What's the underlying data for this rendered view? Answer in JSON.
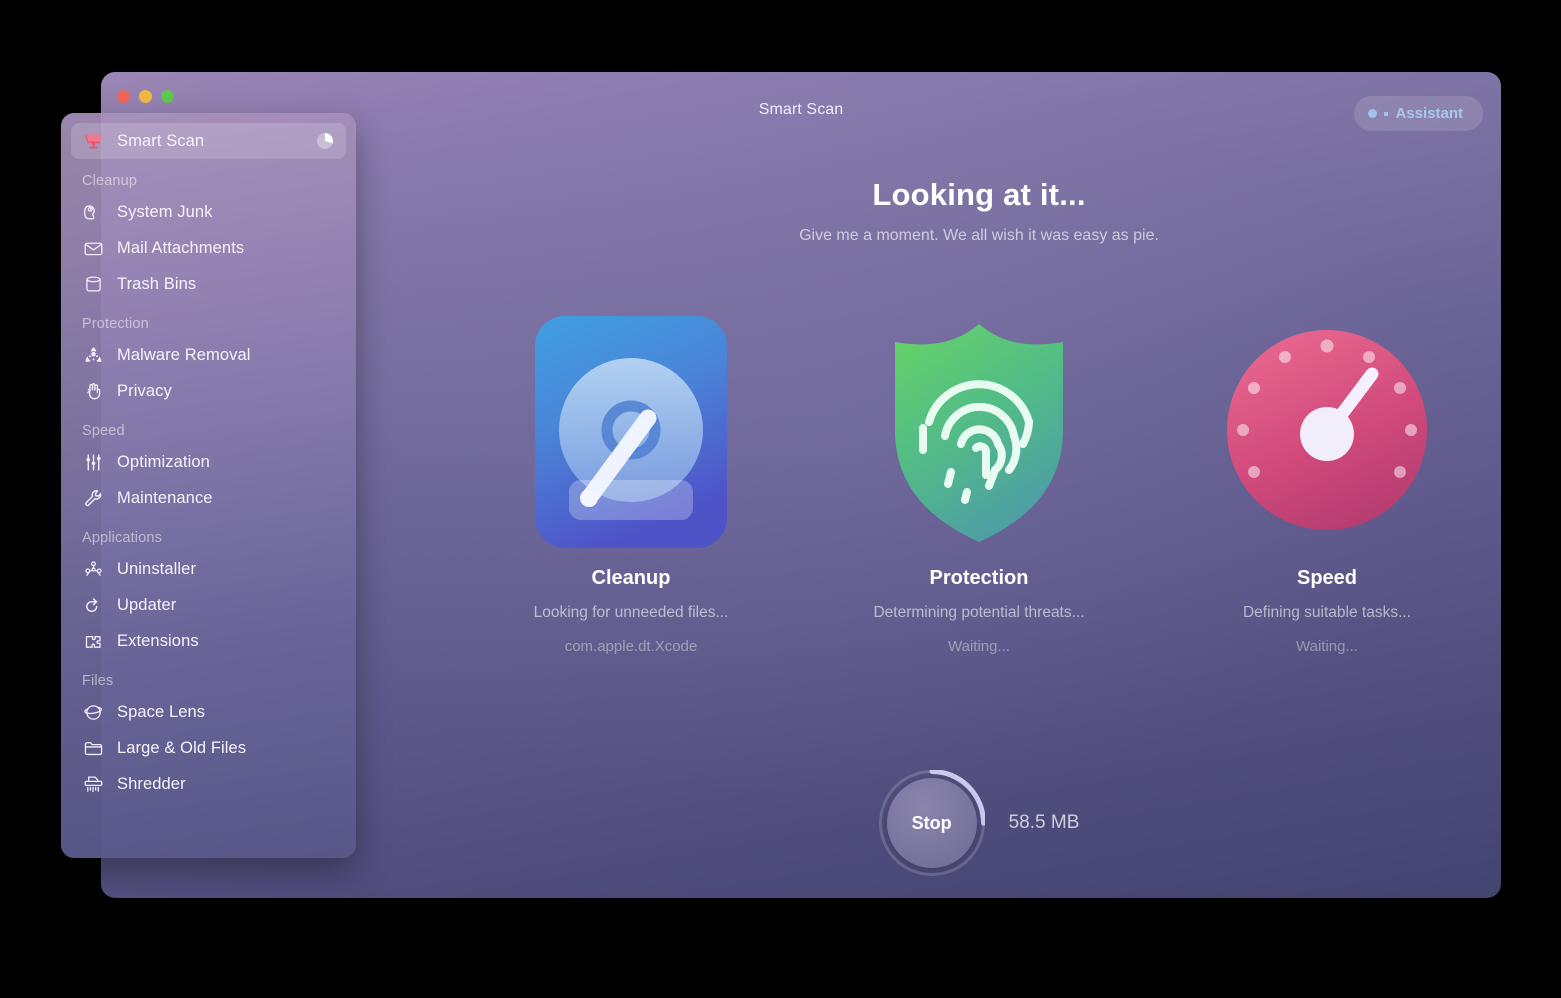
{
  "window": {
    "title": "Smart Scan",
    "traffic_lights": [
      "close",
      "minimize",
      "zoom"
    ],
    "assistant_label": "Assistant"
  },
  "sidebar": {
    "items": [
      {
        "type": "item",
        "label": "Smart Scan",
        "icon": "monitor-icon",
        "selected": true,
        "progress": true
      },
      {
        "type": "group",
        "label": "Cleanup"
      },
      {
        "type": "item",
        "label": "System Junk",
        "icon": "vacuum-icon"
      },
      {
        "type": "item",
        "label": "Mail Attachments",
        "icon": "envelope-icon"
      },
      {
        "type": "item",
        "label": "Trash Bins",
        "icon": "trash-bin-icon"
      },
      {
        "type": "group",
        "label": "Protection"
      },
      {
        "type": "item",
        "label": "Malware Removal",
        "icon": "biohazard-icon"
      },
      {
        "type": "item",
        "label": "Privacy",
        "icon": "hand-icon"
      },
      {
        "type": "group",
        "label": "Speed"
      },
      {
        "type": "item",
        "label": "Optimization",
        "icon": "sliders-icon"
      },
      {
        "type": "item",
        "label": "Maintenance",
        "icon": "wrench-icon"
      },
      {
        "type": "group",
        "label": "Applications"
      },
      {
        "type": "item",
        "label": "Uninstaller",
        "icon": "molecule-icon"
      },
      {
        "type": "item",
        "label": "Updater",
        "icon": "refresh-arrow-icon"
      },
      {
        "type": "item",
        "label": "Extensions",
        "icon": "puzzle-piece-icon"
      },
      {
        "type": "group",
        "label": "Files"
      },
      {
        "type": "item",
        "label": "Space Lens",
        "icon": "planet-icon"
      },
      {
        "type": "item",
        "label": "Large & Old Files",
        "icon": "folder-icon"
      },
      {
        "type": "item",
        "label": "Shredder",
        "icon": "shredder-icon"
      }
    ]
  },
  "main": {
    "headline": "Looking at it...",
    "subheadline": "Give me a moment. We all wish it was easy as pie.",
    "cards": [
      {
        "title": "Cleanup",
        "status": "Looking for unneeded files...",
        "detail": "com.apple.dt.Xcode",
        "icon": "hard-disk-icon",
        "accent": "#4a8fe0"
      },
      {
        "title": "Protection",
        "status": "Determining potential threats...",
        "detail": "Waiting...",
        "icon": "shield-fingerprint-icon",
        "accent": "#5bbf72"
      },
      {
        "title": "Speed",
        "status": "Defining suitable tasks...",
        "detail": "Waiting...",
        "icon": "speedometer-icon",
        "accent": "#d8537f"
      }
    ]
  },
  "footer": {
    "stop_label": "Stop",
    "scan_size": "58.5 MB",
    "progress_percent": 25
  },
  "colors": {
    "window_top": "#9b86b4",
    "window_bottom": "#434370",
    "assistant_accent": "#a8c8ee",
    "progress_arc": "#cfc8ef"
  }
}
